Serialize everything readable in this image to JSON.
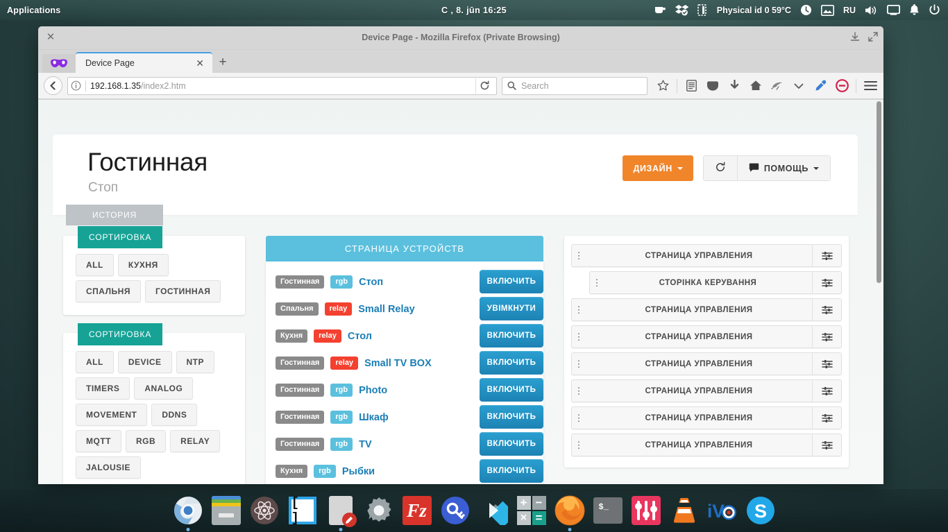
{
  "desktop": {
    "applications_label": "Applications",
    "clock": "С , 8. jūn   16:25",
    "temperature": "Physical id 0 59°C",
    "keyboard_layout": "RU"
  },
  "browser": {
    "window_title": "Device Page - Mozilla Firefox (Private Browsing)",
    "tab_title": "Device Page",
    "url_host": "192.168.1.35",
    "url_path": "/index2.htm",
    "search_placeholder": "Search"
  },
  "page": {
    "title": "Гостинная",
    "subtitle": "Стоп",
    "history_tab": "ИСТОРИЯ",
    "design_button": "ДИЗАЙН",
    "help_button": "ПОМОЩЬ",
    "sort_panel_1": {
      "heading": "СОРТИРОВКА",
      "chips": [
        "ALL",
        "КУХНЯ",
        "СПАЛЬНЯ",
        "ГОСТИННАЯ"
      ]
    },
    "sort_panel_2": {
      "heading": "СОРТИРОВКА",
      "chips": [
        "ALL",
        "DEVICE",
        "NTP",
        "TIMERS",
        "ANALOG",
        "MOVEMENT",
        "DDNS",
        "MQTT",
        "RGB",
        "RELAY",
        "JALOUSIE"
      ]
    },
    "devices_panel": {
      "heading": "СТРАНИЦА УСТРОЙСТВ",
      "rows": [
        {
          "room": "Гостинная",
          "type": "rgb",
          "name": "Стоп",
          "action": "ВКЛЮЧИТЬ"
        },
        {
          "room": "Спальня",
          "type": "relay",
          "name": "Small Relay",
          "action": "УВIМКНУТИ"
        },
        {
          "room": "Кухня",
          "type": "relay",
          "name": "Стол",
          "action": "ВКЛЮЧИТЬ"
        },
        {
          "room": "Гостинная",
          "type": "relay",
          "name": "Small TV BOX",
          "action": "ВКЛЮЧИТЬ"
        },
        {
          "room": "Гостинная",
          "type": "rgb",
          "name": "Photo",
          "action": "ВКЛЮЧИТЬ"
        },
        {
          "room": "Гостинная",
          "type": "rgb",
          "name": "Шкаф",
          "action": "ВКЛЮЧИТЬ"
        },
        {
          "room": "Гостинная",
          "type": "rgb",
          "name": "TV",
          "action": "ВКЛЮЧИТЬ"
        },
        {
          "room": "Кухня",
          "type": "rgb",
          "name": "Рыбки",
          "action": "ВКЛЮЧИТЬ"
        }
      ]
    },
    "control_panel": {
      "items": [
        {
          "label": "СТРАНИЦА УПРАВЛЕНИЯ",
          "indented": false
        },
        {
          "label": "СТОРІНКА КЕРУВАННЯ",
          "indented": true
        },
        {
          "label": "СТРАНИЦА УПРАВЛЕНИЯ",
          "indented": false
        },
        {
          "label": "СТРАНИЦА УПРАВЛЕНИЯ",
          "indented": false
        },
        {
          "label": "СТРАНИЦА УПРАВЛЕНИЯ",
          "indented": false
        },
        {
          "label": "СТРАНИЦА УПРАВЛЕНИЯ",
          "indented": false
        },
        {
          "label": "СТРАНИЦА УПРАВЛЕНИЯ",
          "indented": false
        },
        {
          "label": "СТРАНИЦА УПРАВЛЕНИЯ",
          "indented": false
        }
      ]
    }
  },
  "colors": {
    "orange": "#f0852a",
    "teal": "#16a396",
    "device_header_blue": "#5bc0de",
    "device_button_blue": "#1d83b4",
    "relay_red": "#f4402f",
    "room_gray": "#8a8a8a",
    "history_gray": "#bdc3c7",
    "red_block": "#f4402f",
    "green_stub": "#5cb85c"
  }
}
